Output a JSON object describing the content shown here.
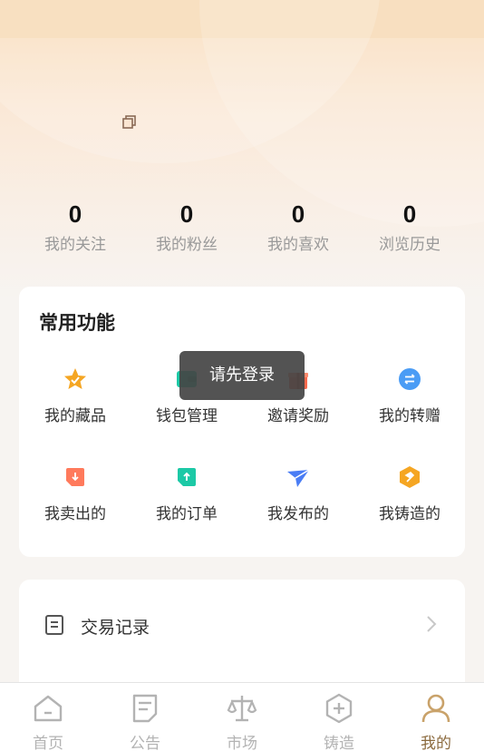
{
  "stats": [
    {
      "value": "0",
      "label": "我的关注"
    },
    {
      "value": "0",
      "label": "我的粉丝"
    },
    {
      "value": "0",
      "label": "我的喜欢"
    },
    {
      "value": "0",
      "label": "浏览历史"
    }
  ],
  "functions": {
    "title": "常用功能",
    "items": [
      {
        "label": "我的藏品",
        "icon": "star-badge-icon",
        "color": "#f5a623"
      },
      {
        "label": "钱包管理",
        "icon": "wallet-icon",
        "color": "#1cc9a6"
      },
      {
        "label": "邀请奖励",
        "icon": "gift-icon",
        "color": "#ff6a4d"
      },
      {
        "label": "我的转赠",
        "icon": "transfer-icon",
        "color": "#4a9cf5"
      },
      {
        "label": "我卖出的",
        "icon": "sold-tag-icon",
        "color": "#ff7a5c"
      },
      {
        "label": "我的订单",
        "icon": "order-tag-icon",
        "color": "#1cc9a6"
      },
      {
        "label": "我发布的",
        "icon": "paper-plane-icon",
        "color": "#4a7df5"
      },
      {
        "label": "我铸造的",
        "icon": "hammer-hexagon-icon",
        "color": "#f5a623"
      }
    ]
  },
  "toast": {
    "text": "请先登录"
  },
  "list": {
    "item_label": "交易记录"
  },
  "tabs": [
    {
      "label": "首页",
      "icon": "home-icon"
    },
    {
      "label": "公告",
      "icon": "notice-icon"
    },
    {
      "label": "市场",
      "icon": "scale-icon"
    },
    {
      "label": "铸造",
      "icon": "mint-hexagon-icon"
    },
    {
      "label": "我的",
      "icon": "user-icon",
      "active": true
    }
  ],
  "colors": {
    "active_tab": "#8b6a3e",
    "inactive_tab": "#b3b3b3",
    "header_accent": "#f7d9b4"
  }
}
